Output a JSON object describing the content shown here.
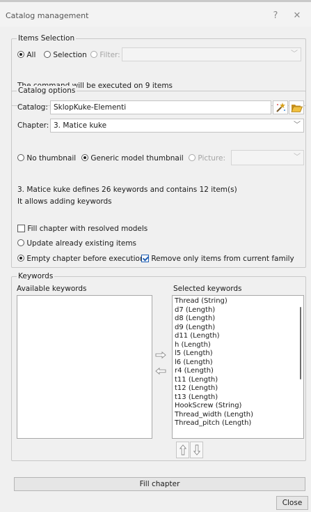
{
  "window": {
    "title": "Catalog management",
    "help_glyph": "?",
    "close_glyph": "✕"
  },
  "items_selection": {
    "legend": "Items Selection",
    "opt_all": "All",
    "opt_selection": "Selection",
    "opt_filter": "Filter:",
    "filter_value": "",
    "message": "The command will be executed on 9 items"
  },
  "catalog_options": {
    "legend": "Catalog options",
    "catalog_label": "Catalog:",
    "catalog_value": "SklopKuke-Elementi",
    "chapter_label": "Chapter:",
    "chapter_value": "3. Matice kuke",
    "thumb_none": "No thumbnail",
    "thumb_generic": "Generic model thumbnail",
    "thumb_picture": "Picture:",
    "picture_value": "",
    "info_line1": "3. Matice kuke defines 26 keywords and contains 12 item(s)",
    "info_line2": "It allows adding keywords",
    "fill_resolved": "Fill chapter with resolved models",
    "update_existing": "Update already existing items",
    "empty_before": "Empty chapter before execution",
    "remove_only": "Remove only items from current family"
  },
  "keywords": {
    "legend": "Keywords",
    "available_label": "Available keywords",
    "selected_label": "Selected keywords",
    "available": [],
    "selected": [
      "Thread (String)",
      "d7 (Length)",
      "d8 (Length)",
      "d9 (Length)",
      "d11 (Length)",
      "h (Length)",
      "l5 (Length)",
      "l6 (Length)",
      "r4 (Length)",
      "t11 (Length)",
      "t12 (Length)",
      "t13 (Length)",
      "HookScrew (String)",
      "Thread_width (Length)",
      "Thread_pitch (Length)"
    ]
  },
  "actions": {
    "fill_chapter": "Fill chapter",
    "close": "Close"
  },
  "colors": {
    "accent": "#1f5fb4",
    "wand": "#d8a019",
    "folder": "#e0b22e"
  }
}
